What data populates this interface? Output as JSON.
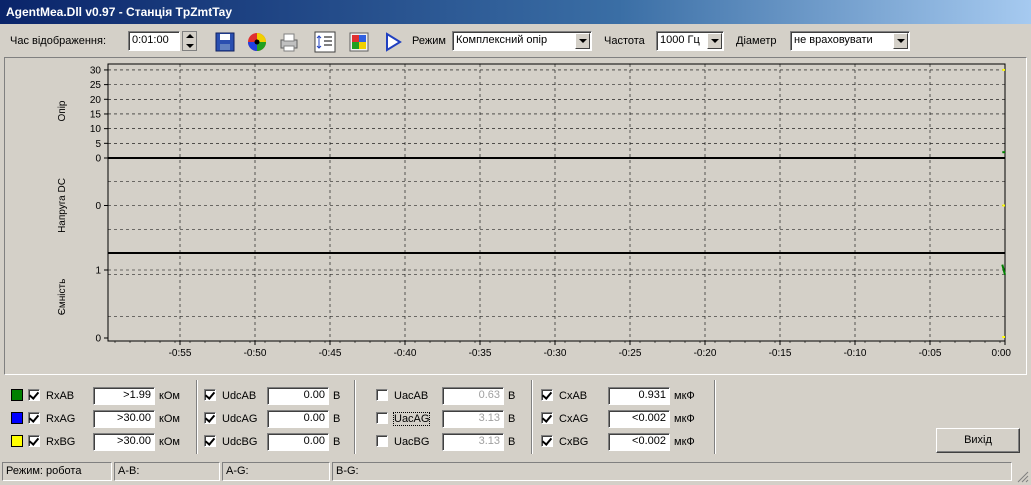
{
  "window": {
    "title": "AgentMea.Dll v0.97 - Станція TpZmtTay"
  },
  "toolbar": {
    "display_time_label": "Час відображення:",
    "display_time_value": "0:01:00",
    "mode_label": "Режим",
    "mode_value": "Комплексний опір",
    "frequency_label": "Частота",
    "frequency_value": "1000 Гц",
    "diameter_label": "Діаметр",
    "diameter_value": "не враховувати",
    "icons": [
      "save-icon",
      "color-wheel-icon",
      "print-icon",
      "list-settings-icon",
      "palette-icon",
      "play-icon"
    ]
  },
  "chart_data": {
    "type": "line",
    "grid": true,
    "x_ticks": [
      "-0:55",
      "-0:50",
      "-0:45",
      "-0:40",
      "-0:35",
      "-0:30",
      "-0:25",
      "-0:20",
      "-0:15",
      "-0:10",
      "-0:05",
      "0:00"
    ],
    "panels": [
      {
        "ylabel": "Опір",
        "y_ticks": [
          "30",
          "25",
          "20",
          "15",
          "10",
          "5",
          "0"
        ],
        "ylim": [
          0,
          31
        ],
        "series": [
          {
            "color": "#ffff00",
            "x": [
              -0.003,
              0
            ],
            "y": [
              30,
              30
            ]
          },
          {
            "color": "#008000",
            "x": [
              -0.003,
              0
            ],
            "y": [
              1.99,
              1.99
            ]
          }
        ]
      },
      {
        "ylabel": "Напруга DC",
        "y_ticks": [
          "0"
        ],
        "ylim": [
          -1,
          1
        ],
        "series": [
          {
            "color": "#ffff00",
            "x": [
              -0.003,
              0
            ],
            "y": [
              0,
              0
            ]
          }
        ]
      },
      {
        "ylabel": "Ємність",
        "y_ticks": [
          "1",
          "0"
        ],
        "ylim": [
          0,
          1.25
        ],
        "series": [
          {
            "color": "#008000",
            "x": [
              -0.003,
              0
            ],
            "y": [
              1.08,
              0.931
            ]
          },
          {
            "color": "#ffff00",
            "x": [
              -0.003,
              0
            ],
            "y": [
              0,
              0
            ]
          }
        ]
      }
    ]
  },
  "measurements": {
    "resistance": [
      {
        "label": "RxAB",
        "value": ">1.99",
        "unit": "кОм",
        "color": "#008000",
        "checked": true
      },
      {
        "label": "RxAG",
        "value": ">30.00",
        "unit": "кОм",
        "color": "#0000ff",
        "checked": true
      },
      {
        "label": "RxBG",
        "value": ">30.00",
        "unit": "кОм",
        "color": "#ffff00",
        "checked": true
      }
    ],
    "udc": [
      {
        "label": "UdcAB",
        "value": "0.00",
        "unit": "В",
        "checked": true
      },
      {
        "label": "UdcAG",
        "value": "0.00",
        "unit": "В",
        "checked": true
      },
      {
        "label": "UdcBG",
        "value": "0.00",
        "unit": "В",
        "checked": true
      }
    ],
    "uac": [
      {
        "label": "UacAB",
        "value": "0.63",
        "unit": "В",
        "checked": false
      },
      {
        "label": "UacAG",
        "value": "3.13",
        "unit": "В",
        "checked": false
      },
      {
        "label": "UacBG",
        "value": "3.13",
        "unit": "В",
        "checked": false
      }
    ],
    "cx": [
      {
        "label": "CxAB",
        "value": "0.931",
        "unit": "мкФ",
        "checked": true
      },
      {
        "label": "CxAG",
        "value": "<0.002",
        "unit": "мкФ",
        "checked": true
      },
      {
        "label": "CxBG",
        "value": "<0.002",
        "unit": "мкФ",
        "checked": true
      }
    ]
  },
  "exit_button": "Вихід",
  "status": {
    "mode": "Режим: робота",
    "ab": "А-В:",
    "ag": "А-G:",
    "bg": "В-G:"
  }
}
